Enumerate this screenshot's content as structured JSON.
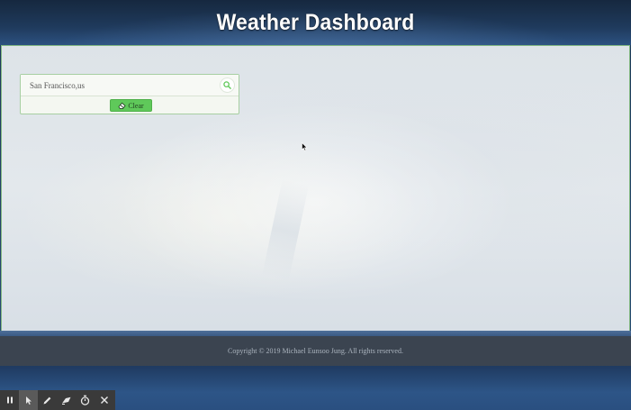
{
  "header": {
    "title": "Weather Dashboard"
  },
  "search": {
    "value": "San Francisco,us",
    "search_icon": "search-icon",
    "clear_icon": "eraser-icon",
    "clear_label": "Clear"
  },
  "footer": {
    "copyright": "Copyright © 2019 Michael Eunsoo Jung. All rights reserved."
  },
  "recording_toolbar": {
    "tools": [
      "pause-icon",
      "pointer-icon",
      "pen-icon",
      "highlighter-icon",
      "timer-icon",
      "close-icon"
    ]
  },
  "colors": {
    "accent_green": "#5fc95a",
    "header_bg": "#1f3a5c",
    "footer_bg": "#3b4450"
  }
}
